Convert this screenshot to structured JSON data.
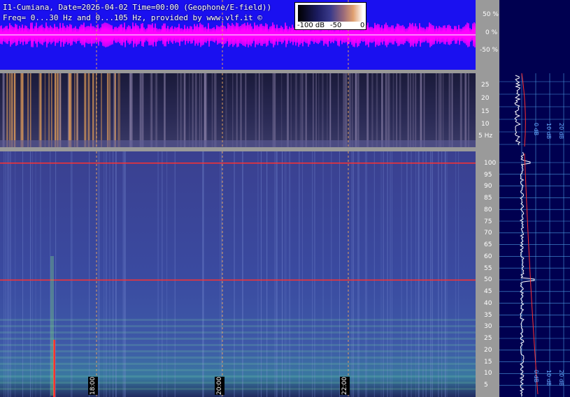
{
  "header": {
    "line1": "I1-Cumiana, Date=2026-04-02 Time=00:00 (Geophone/E-field))",
    "line2": "Freq= 0...30 Hz and 0...105 Hz, provided by www.vlf.it ©"
  },
  "colorbar": {
    "labels": [
      "-100 dB",
      "-50",
      "0"
    ]
  },
  "amplitude_axis": [
    "50 %",
    "0 %",
    "-50 %"
  ],
  "top_freq_axis": [
    "25",
    "20",
    "15",
    "10",
    "5 Hz"
  ],
  "bottom_freq_axis": [
    "100",
    "95",
    "90",
    "85",
    "80",
    "75",
    "70",
    "65",
    "60",
    "55",
    "50",
    "45",
    "40",
    "35",
    "30",
    "25",
    "20",
    "15",
    "10",
    "5"
  ],
  "time_labels": [
    "18:00",
    "20:00",
    "22:00"
  ],
  "top_spectrum_db_labels": [
    "0 dB",
    "10 dB",
    "20 dB"
  ],
  "bottom_spectrum_db_labels": [
    "0 dB",
    "10 dB",
    "20 dB"
  ],
  "colors": {
    "signal": "#ff00ff",
    "background": "#1a10f0",
    "axis": "#9a9a9a",
    "panel": "#000050",
    "grid": "#4a9ae0",
    "marker": "#ff3030"
  }
}
